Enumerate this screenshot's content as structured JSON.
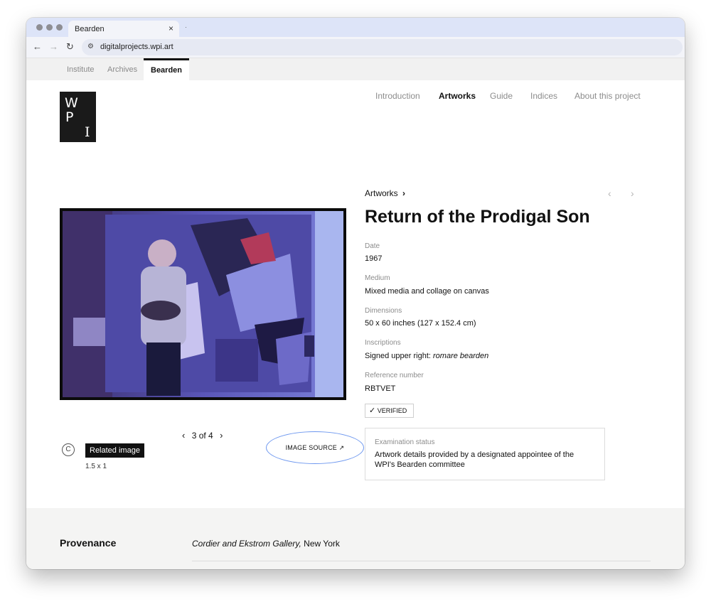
{
  "browser": {
    "tab_title": "Bearden",
    "tab_close": "×",
    "new_tab": "·",
    "url": "digitalprojects.wpi.art",
    "nav": {
      "back": "←",
      "forward": "→",
      "reload": "↻",
      "site_settings": "⚙"
    }
  },
  "site_switcher": [
    "Institute",
    "Archives",
    "Bearden"
  ],
  "logo": {
    "letters": [
      "W",
      "P",
      "I"
    ]
  },
  "main_nav": [
    "Introduction",
    "Artworks",
    "Guide",
    "Indices",
    "About this project"
  ],
  "breadcrumb": {
    "label": "Artworks",
    "chevron": "›"
  },
  "arrows": {
    "prev": "‹",
    "next": "›"
  },
  "artwork": {
    "title": "Return of the Prodigal Son",
    "fields": [
      {
        "label": "Date",
        "value": "1967"
      },
      {
        "label": "Medium",
        "value": "Mixed media and collage on canvas"
      },
      {
        "label": "Dimensions",
        "value": "50 x 60 inches (127 x 152.4 cm)"
      },
      {
        "label": "Inscriptions",
        "value": "Signed upper right:",
        "value_italic": "romare bearden"
      },
      {
        "label": "Reference number",
        "value": "RBTVET"
      }
    ],
    "verified": "VERIFIED",
    "examination": {
      "label": "Examination status",
      "text": "Artwork details provided by a designated appointee of the WPI's Bearden committee"
    }
  },
  "image_panel": {
    "copyright": "C",
    "related_image": "Related image",
    "ratio": "1.5 x 1",
    "pager": "3 of 4",
    "image_source": "IMAGE SOURCE ↗"
  },
  "provenance": {
    "label": "Provenance",
    "entry_italic": "Cordier and Ekstrom Gallery,",
    "entry_rest": "New York"
  },
  "colors": {
    "accent_ellipse": "#6d97ef",
    "logo_bg": "#1a1a1a",
    "band_bg": "#f4f4f3"
  }
}
